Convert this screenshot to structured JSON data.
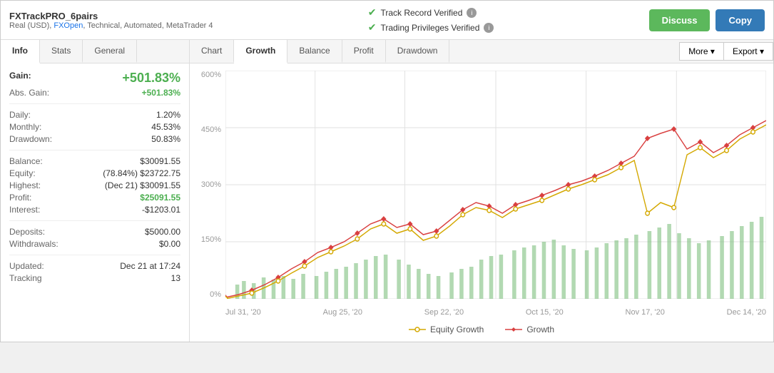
{
  "header": {
    "title": "FXTrackPRO_6pairs",
    "subtitle": "Real (USD), FXOpen, Technical, Automated, MetaTrader 4",
    "verified": [
      "Track Record Verified",
      "Trading Privileges Verified"
    ],
    "discuss_label": "Discuss",
    "copy_label": "Copy"
  },
  "left_tabs": [
    {
      "label": "Info",
      "active": true
    },
    {
      "label": "Stats",
      "active": false
    },
    {
      "label": "General",
      "active": false
    }
  ],
  "info": {
    "gain_label": "Gain:",
    "gain_value": "+501.83%",
    "abs_gain_label": "Abs. Gain:",
    "abs_gain_value": "+501.83%",
    "daily_label": "Daily:",
    "daily_value": "1.20%",
    "monthly_label": "Monthly:",
    "monthly_value": "45.53%",
    "drawdown_label": "Drawdown:",
    "drawdown_value": "50.83%",
    "balance_label": "Balance:",
    "balance_value": "$30091.55",
    "equity_label": "Equity:",
    "equity_value": "(78.84%) $23722.75",
    "highest_label": "Highest:",
    "highest_value": "(Dec 21) $30091.55",
    "profit_label": "Profit:",
    "profit_value": "$25091.55",
    "interest_label": "Interest:",
    "interest_value": "-$1203.01",
    "deposits_label": "Deposits:",
    "deposits_value": "$5000.00",
    "withdrawals_label": "Withdrawals:",
    "withdrawals_value": "$0.00",
    "updated_label": "Updated:",
    "updated_value": "Dec 21 at 17:24",
    "tracking_label": "Tracking",
    "tracking_value": "13"
  },
  "chart_tabs": [
    {
      "label": "Chart",
      "active": false
    },
    {
      "label": "Growth",
      "active": true
    },
    {
      "label": "Balance",
      "active": false
    },
    {
      "label": "Profit",
      "active": false
    },
    {
      "label": "Drawdown",
      "active": false
    }
  ],
  "chart_controls": [
    {
      "label": "More",
      "has_arrow": true
    },
    {
      "label": "Export",
      "has_arrow": true
    }
  ],
  "chart": {
    "y_labels": [
      "600%",
      "450%",
      "300%",
      "150%",
      "0%"
    ],
    "x_labels": [
      "Jul 31, '20",
      "Aug 25, '20",
      "Sep 22, '20",
      "Oct 15, '20",
      "Nov 17, '20",
      "Dec 14, '20"
    ],
    "legend": [
      {
        "label": "Equity Growth",
        "color": "#f0c030",
        "type": "circle"
      },
      {
        "label": "Growth",
        "color": "#e03030",
        "type": "diamond"
      }
    ]
  }
}
